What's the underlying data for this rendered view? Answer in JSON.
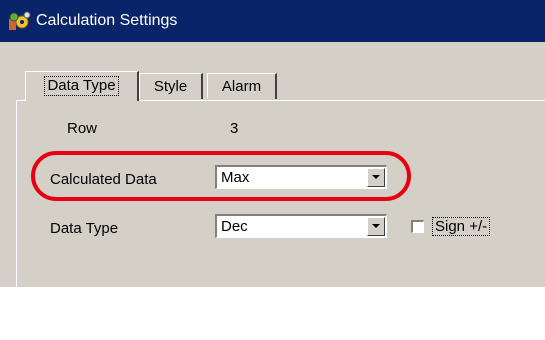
{
  "window": {
    "title": "Calculation Settings",
    "title_icon": "gears-icon",
    "colors": {
      "titlebar": "#0a246a",
      "face": "#d4d0c8",
      "highlight_ring": "#e60012"
    }
  },
  "tabs": [
    {
      "label": "Data Type",
      "selected": true
    },
    {
      "label": "Style",
      "selected": false
    },
    {
      "label": "Alarm",
      "selected": false
    }
  ],
  "form": {
    "row": {
      "label": "Row",
      "value": "3"
    },
    "calculated_data": {
      "label": "Calculated Data",
      "value": "Max"
    },
    "data_type": {
      "label": "Data Type",
      "value": "Dec"
    },
    "sign": {
      "label": "Sign +/-",
      "checked": false
    }
  }
}
